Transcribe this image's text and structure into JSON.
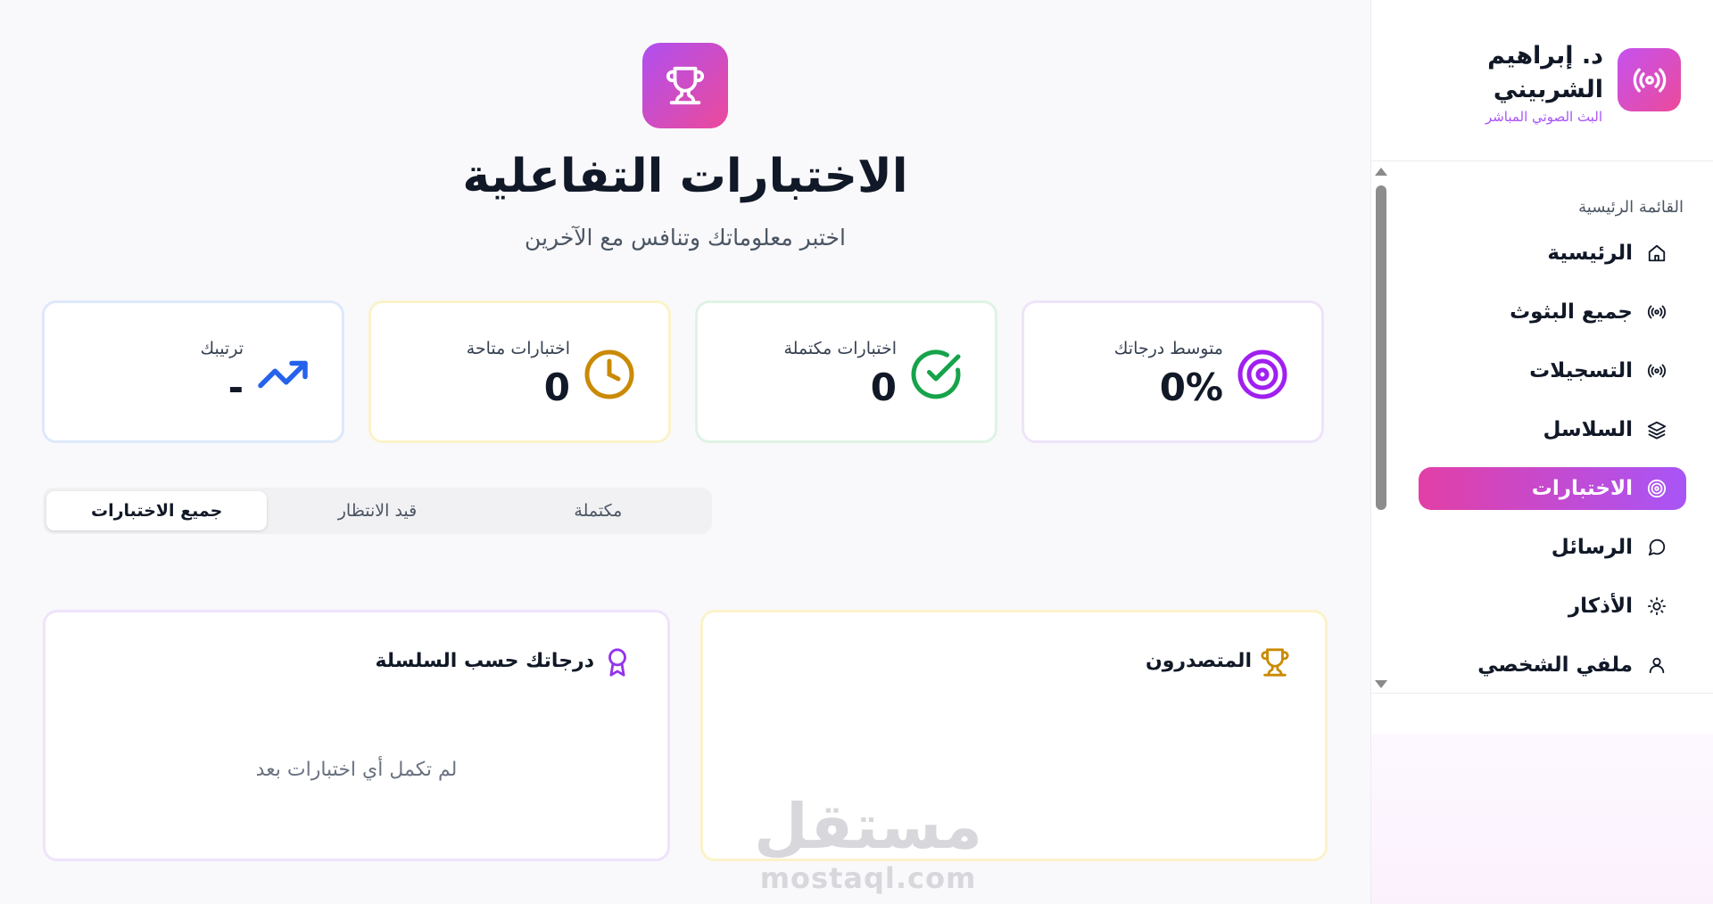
{
  "sidebar": {
    "brand_name": "د. إبراهيم الشربيني",
    "brand_subtitle": "البث الصوتي المباشر",
    "section_title": "القائمة الرئيسية",
    "items": [
      {
        "label": "الرئيسية",
        "icon": "home-icon"
      },
      {
        "label": "جميع البثوث",
        "icon": "broadcast-icon"
      },
      {
        "label": "التسجيلات",
        "icon": "broadcast-icon"
      },
      {
        "label": "السلاسل",
        "icon": "layers-icon"
      },
      {
        "label": "الاختبارات",
        "icon": "target-icon",
        "active": true
      },
      {
        "label": "الرسائل",
        "icon": "message-icon"
      },
      {
        "label": "الأذكار",
        "icon": "sun-icon"
      },
      {
        "label": "ملفي الشخصي",
        "icon": "user-icon"
      }
    ]
  },
  "header": {
    "title": "الاختبارات التفاعلية",
    "subtitle": "اختبر معلوماتك وتنافس مع الآخرين"
  },
  "stats": [
    {
      "label": "متوسط درجاتك",
      "value": "0%",
      "icon": "target-icon",
      "color": "#a020f0"
    },
    {
      "label": "اختبارات مكتملة",
      "value": "0",
      "icon": "check-circle-icon",
      "color": "#16a34a"
    },
    {
      "label": "اختبارات متاحة",
      "value": "0",
      "icon": "clock-icon",
      "color": "#ca8a04"
    },
    {
      "label": "ترتيبك",
      "value": "-",
      "icon": "trending-up-icon",
      "color": "#2563eb"
    }
  ],
  "tabs": [
    {
      "label": "جميع الاختبارات",
      "active": true
    },
    {
      "label": "قيد الانتظار"
    },
    {
      "label": "مكتملة"
    }
  ],
  "panels": {
    "leaderboard": {
      "title": "المتصدرون",
      "icon": "trophy-icon"
    },
    "series_scores": {
      "title": "درجاتك حسب السلسلة",
      "icon": "award-icon",
      "empty_text": "لم تكمل أي اختبارات بعد"
    }
  },
  "watermark": {
    "arabic": "مستقل",
    "latin": "mostaql.com"
  }
}
